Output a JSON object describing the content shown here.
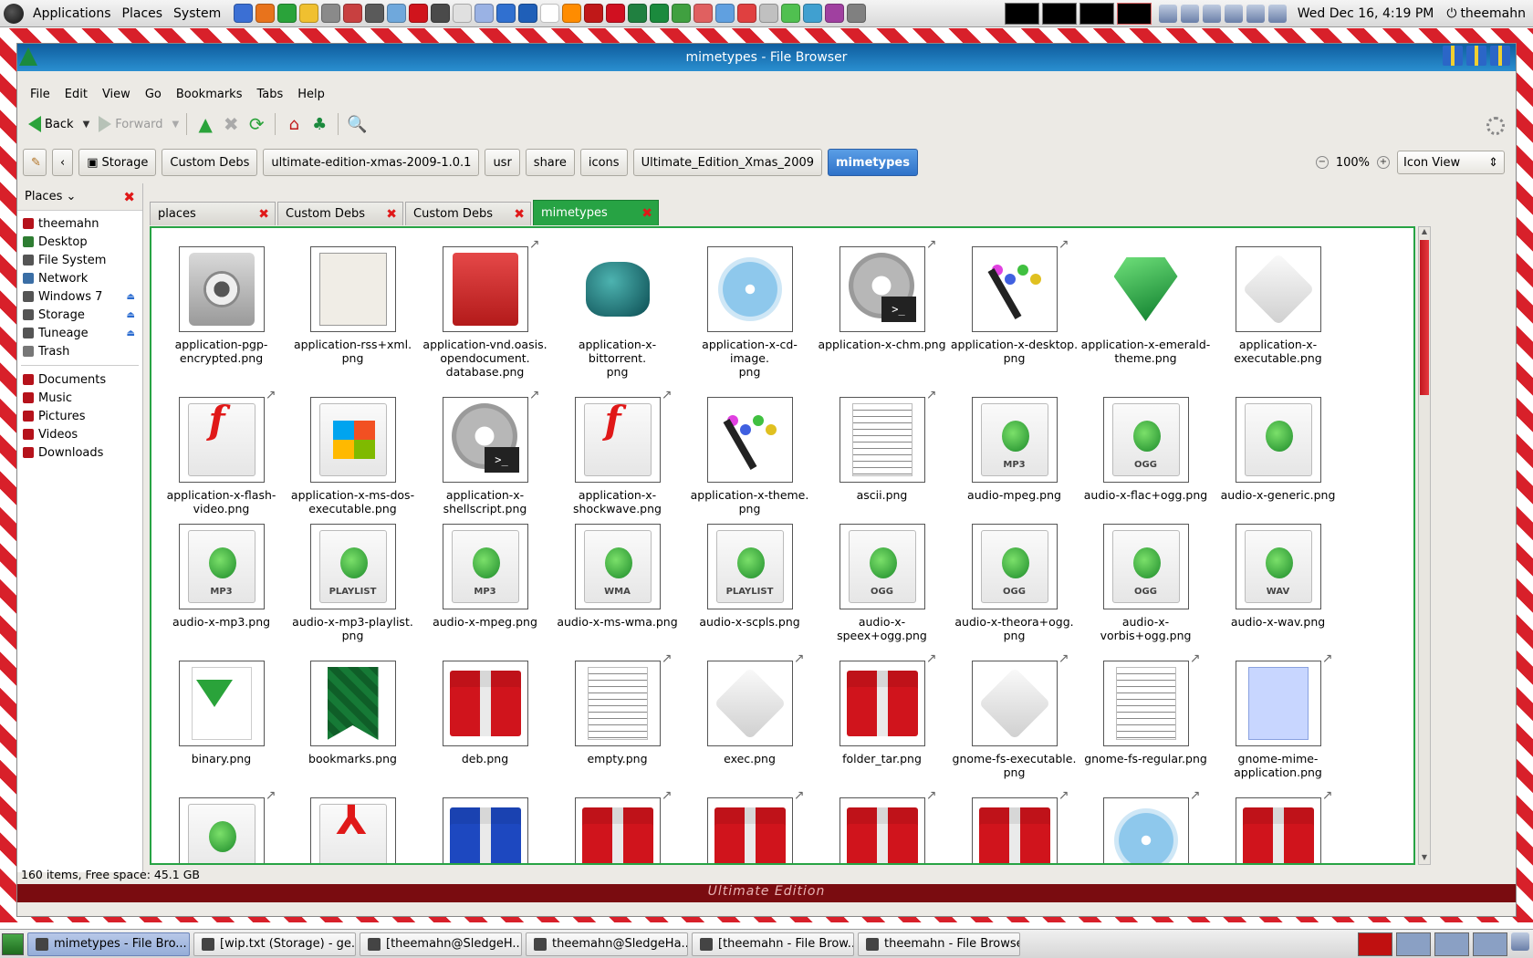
{
  "top_panel": {
    "menus": [
      "Applications",
      "Places",
      "System"
    ],
    "launcher_colors": [
      "#3b6fd4",
      "#e8731c",
      "#2aa33a",
      "#f0c030",
      "#8a8a8a",
      "#c84040",
      "#5a5a5a",
      "#6fa8dc",
      "#d0141c",
      "#4a4a4a",
      "#e0e0e0",
      "#9ab2e4",
      "#3070d0",
      "#1f5fb8",
      "#ffffff",
      "#ff8c00",
      "#c01818",
      "#d01020",
      "#208040",
      "#1b8a3d",
      "#40a040",
      "#e06060",
      "#60a0e0",
      "#e04040",
      "#c0c0c0",
      "#50c050",
      "#40a0d0",
      "#a040a0",
      "#808080"
    ],
    "clock": "Wed Dec 16,  4:19 PM",
    "user": "theemahn"
  },
  "window": {
    "title": "mimetypes - File Browser",
    "menu": [
      "File",
      "Edit",
      "View",
      "Go",
      "Bookmarks",
      "Tabs",
      "Help"
    ],
    "toolbar": {
      "back": "Back",
      "forward": "Forward"
    },
    "breadcrumbs": [
      "Storage",
      "Custom Debs",
      "ultimate-edition-xmas-2009-1.0.1",
      "usr",
      "share",
      "icons",
      "Ultimate_Edition_Xmas_2009",
      "mimetypes"
    ],
    "zoom": "100%",
    "view_mode": "Icon View"
  },
  "sidebar": {
    "header": "Places",
    "items": [
      {
        "label": "theemahn",
        "color": "#b5121b",
        "eject": false
      },
      {
        "label": "Desktop",
        "color": "#2e7d32",
        "eject": false
      },
      {
        "label": "File System",
        "color": "#555555",
        "eject": false
      },
      {
        "label": "Network",
        "color": "#3a6ea5",
        "eject": false
      },
      {
        "label": "Windows 7",
        "color": "#555555",
        "eject": true
      },
      {
        "label": "Storage",
        "color": "#555555",
        "eject": true
      },
      {
        "label": "Tuneage",
        "color": "#555555",
        "eject": true
      },
      {
        "label": "Trash",
        "color": "#777777",
        "eject": false
      }
    ],
    "bookmarks": [
      {
        "label": "Documents",
        "color": "#b5121b"
      },
      {
        "label": "Music",
        "color": "#b5121b"
      },
      {
        "label": "Pictures",
        "color": "#b5121b"
      },
      {
        "label": "Videos",
        "color": "#b5121b"
      },
      {
        "label": "Downloads",
        "color": "#b5121b"
      }
    ]
  },
  "tabs": [
    {
      "label": "places",
      "active": false
    },
    {
      "label": "Custom Debs",
      "active": false
    },
    {
      "label": "Custom Debs",
      "active": false
    },
    {
      "label": "mimetypes",
      "active": true
    }
  ],
  "files": [
    {
      "name": "application-pgp-encrypted.png",
      "lines": [
        "application-pgp-",
        "encrypted.png"
      ],
      "icon": "safe",
      "link": false
    },
    {
      "name": "application-rss+xml.png",
      "lines": [
        "application-rss+xml.",
        "png"
      ],
      "icon": "newspaper",
      "link": false
    },
    {
      "name": "application-vnd.oasis.opendocument.database.png",
      "lines": [
        "application-vnd.oasis.",
        "opendocument.",
        "database.png"
      ],
      "icon": "db",
      "link": true
    },
    {
      "name": "application-x-bittorrent.png",
      "lines": [
        "application-x-bittorrent.",
        "png"
      ],
      "icon": "frog",
      "link": false
    },
    {
      "name": "application-x-cd-image.png",
      "lines": [
        "application-x-cd-image.",
        "png"
      ],
      "icon": "cd",
      "link": false
    },
    {
      "name": "application-x-chm.png",
      "lines": [
        "application-x-chm.png"
      ],
      "icon": "gear",
      "link": true
    },
    {
      "name": "application-x-desktop.png",
      "lines": [
        "application-x-desktop.",
        "png"
      ],
      "icon": "palette",
      "link": true
    },
    {
      "name": "application-x-emerald-theme.png",
      "lines": [
        "application-x-emerald-",
        "theme.png"
      ],
      "icon": "gem",
      "link": false
    },
    {
      "name": "application-x-executable.png",
      "lines": [
        "application-x-",
        "executable.png"
      ],
      "icon": "cube",
      "link": false
    },
    {
      "name": "application-x-flash-video.png",
      "lines": [
        "application-x-flash-",
        "video.png"
      ],
      "icon": "flash",
      "link": true
    },
    {
      "name": "application-x-ms-dos-executable.png",
      "lines": [
        "application-x-ms-dos-",
        "executable.png"
      ],
      "icon": "windows",
      "link": false
    },
    {
      "name": "application-x-shellscript.png",
      "lines": [
        "application-x-",
        "shellscript.png"
      ],
      "icon": "gear",
      "link": true
    },
    {
      "name": "application-x-shockwave.png",
      "lines": [
        "application-x-",
        "shockwave.png"
      ],
      "icon": "flash",
      "link": true
    },
    {
      "name": "application-x-theme.png",
      "lines": [
        "application-x-theme.",
        "png"
      ],
      "icon": "palette",
      "link": false
    },
    {
      "name": "ascii.png",
      "lines": [
        "ascii.png"
      ],
      "icon": "paper",
      "link": true
    },
    {
      "name": "audio-mpeg.png",
      "lines": [
        "audio-mpeg.png"
      ],
      "icon": "audio",
      "badge": "MP3",
      "link": false
    },
    {
      "name": "audio-x-flac+ogg.png",
      "lines": [
        "audio-x-flac+ogg.png"
      ],
      "icon": "audio",
      "badge": "OGG",
      "link": false
    },
    {
      "name": "audio-x-generic.png",
      "lines": [
        "audio-x-generic.png"
      ],
      "icon": "audio",
      "badge": "",
      "link": false
    },
    {
      "name": "audio-x-mp3.png",
      "lines": [
        "audio-x-mp3.png"
      ],
      "icon": "audio",
      "badge": "MP3",
      "link": false
    },
    {
      "name": "audio-x-mp3-playlist.png",
      "lines": [
        "audio-x-mp3-playlist.",
        "png"
      ],
      "icon": "audio",
      "badge": "PLAYLIST",
      "link": false
    },
    {
      "name": "audio-x-mpeg.png",
      "lines": [
        "audio-x-mpeg.png"
      ],
      "icon": "audio",
      "badge": "MP3",
      "link": false
    },
    {
      "name": "audio-x-ms-wma.png",
      "lines": [
        "audio-x-ms-wma.png"
      ],
      "icon": "audio",
      "badge": "WMA",
      "link": false
    },
    {
      "name": "audio-x-scpls.png",
      "lines": [
        "audio-x-scpls.png"
      ],
      "icon": "audio",
      "badge": "PLAYLIST",
      "link": false
    },
    {
      "name": "audio-x-speex+ogg.png",
      "lines": [
        "audio-x-speex+ogg.png"
      ],
      "icon": "audio",
      "badge": "OGG",
      "link": false
    },
    {
      "name": "audio-x-theora+ogg.png",
      "lines": [
        "audio-x-theora+ogg.",
        "png"
      ],
      "icon": "audio",
      "badge": "OGG",
      "link": false
    },
    {
      "name": "audio-x-vorbis+ogg.png",
      "lines": [
        "audio-x-vorbis+ogg.png"
      ],
      "icon": "audio",
      "badge": "OGG",
      "link": false
    },
    {
      "name": "audio-x-wav.png",
      "lines": [
        "audio-x-wav.png"
      ],
      "icon": "audio",
      "badge": "WAV",
      "link": false
    },
    {
      "name": "binary.png",
      "lines": [
        "binary.png"
      ],
      "icon": "binary",
      "link": false
    },
    {
      "name": "bookmarks.png",
      "lines": [
        "bookmarks.png"
      ],
      "icon": "ribbon",
      "link": false
    },
    {
      "name": "deb.png",
      "lines": [
        "deb.png"
      ],
      "icon": "gift",
      "link": false
    },
    {
      "name": "empty.png",
      "lines": [
        "empty.png"
      ],
      "icon": "paper",
      "link": true
    },
    {
      "name": "exec.png",
      "lines": [
        "exec.png"
      ],
      "icon": "cube",
      "link": true
    },
    {
      "name": "folder_tar.png",
      "lines": [
        "folder_tar.png"
      ],
      "icon": "gift",
      "link": true
    },
    {
      "name": "gnome-fs-executable.png",
      "lines": [
        "gnome-fs-executable.",
        "png"
      ],
      "icon": "cube",
      "link": true
    },
    {
      "name": "gnome-fs-regular.png",
      "lines": [
        "gnome-fs-regular.png"
      ],
      "icon": "paper",
      "link": true
    },
    {
      "name": "gnome-mime-application.png",
      "lines": [
        "gnome-mime-",
        "application.png"
      ],
      "icon": "paperblue",
      "link": true
    },
    {
      "name": "",
      "lines": [],
      "icon": "audio",
      "badge": "",
      "link": true
    },
    {
      "name": "",
      "lines": [],
      "icon": "pdf",
      "link": false
    },
    {
      "name": "",
      "lines": [],
      "icon": "giftblue",
      "link": false
    },
    {
      "name": "",
      "lines": [],
      "icon": "gift",
      "link": true
    },
    {
      "name": "",
      "lines": [],
      "icon": "gift",
      "link": true
    },
    {
      "name": "",
      "lines": [],
      "icon": "gift",
      "link": true
    },
    {
      "name": "",
      "lines": [],
      "icon": "gift",
      "link": true
    },
    {
      "name": "",
      "lines": [],
      "icon": "cd",
      "link": true
    },
    {
      "name": "",
      "lines": [],
      "icon": "gift",
      "link": true
    }
  ],
  "statusbar": "160 items, Free space: 45.1 GB",
  "brand_strip": "Ultimate Edition",
  "taskbar": [
    {
      "label": "mimetypes - File Bro...",
      "active": true
    },
    {
      "label": "[wip.txt (Storage) - ge...",
      "active": false
    },
    {
      "label": "[theemahn@SledgeH...",
      "active": false
    },
    {
      "label": "theemahn@SledgeHa...",
      "active": false
    },
    {
      "label": "[theemahn - File Brow...",
      "active": false
    },
    {
      "label": "theemahn - File Browser",
      "active": false
    }
  ]
}
